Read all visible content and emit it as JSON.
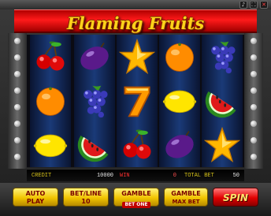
{
  "game": {
    "title": "Flaming Fruits"
  },
  "top_controls": {
    "icons": [
      "sound-icon",
      "fullscreen-icon",
      "close-icon"
    ]
  },
  "reels": [
    [
      "cherries",
      "orange",
      "lemon"
    ],
    [
      "plum",
      "grapes",
      "watermelon"
    ],
    [
      "star",
      "seven",
      "cherries"
    ],
    [
      "orange",
      "lemon",
      "plum"
    ],
    [
      "grapes",
      "watermelon",
      "star"
    ]
  ],
  "info": {
    "credit_label": "CREDIT",
    "credit_value": "10000",
    "win_label": "WIN",
    "win_value": "0",
    "total_bet_label": "TOTAL BET",
    "total_bet_value": "50"
  },
  "buttons": {
    "auto_play": [
      "AUTO",
      "PLAY"
    ],
    "bet_line": [
      "BET/LINE",
      "10"
    ],
    "gamble_bet_one": [
      "GAMBLE",
      "BET ONE"
    ],
    "gamble_max_bet": [
      "GAMBLE",
      "MAX BET"
    ],
    "spin": "SPIN"
  },
  "colors": {
    "banner_red": "#e00000",
    "title_gold": "#ffd21a",
    "reel_blue": "#1a3a78",
    "button_yellow": "#f1c400",
    "spin_red": "#e00000"
  }
}
